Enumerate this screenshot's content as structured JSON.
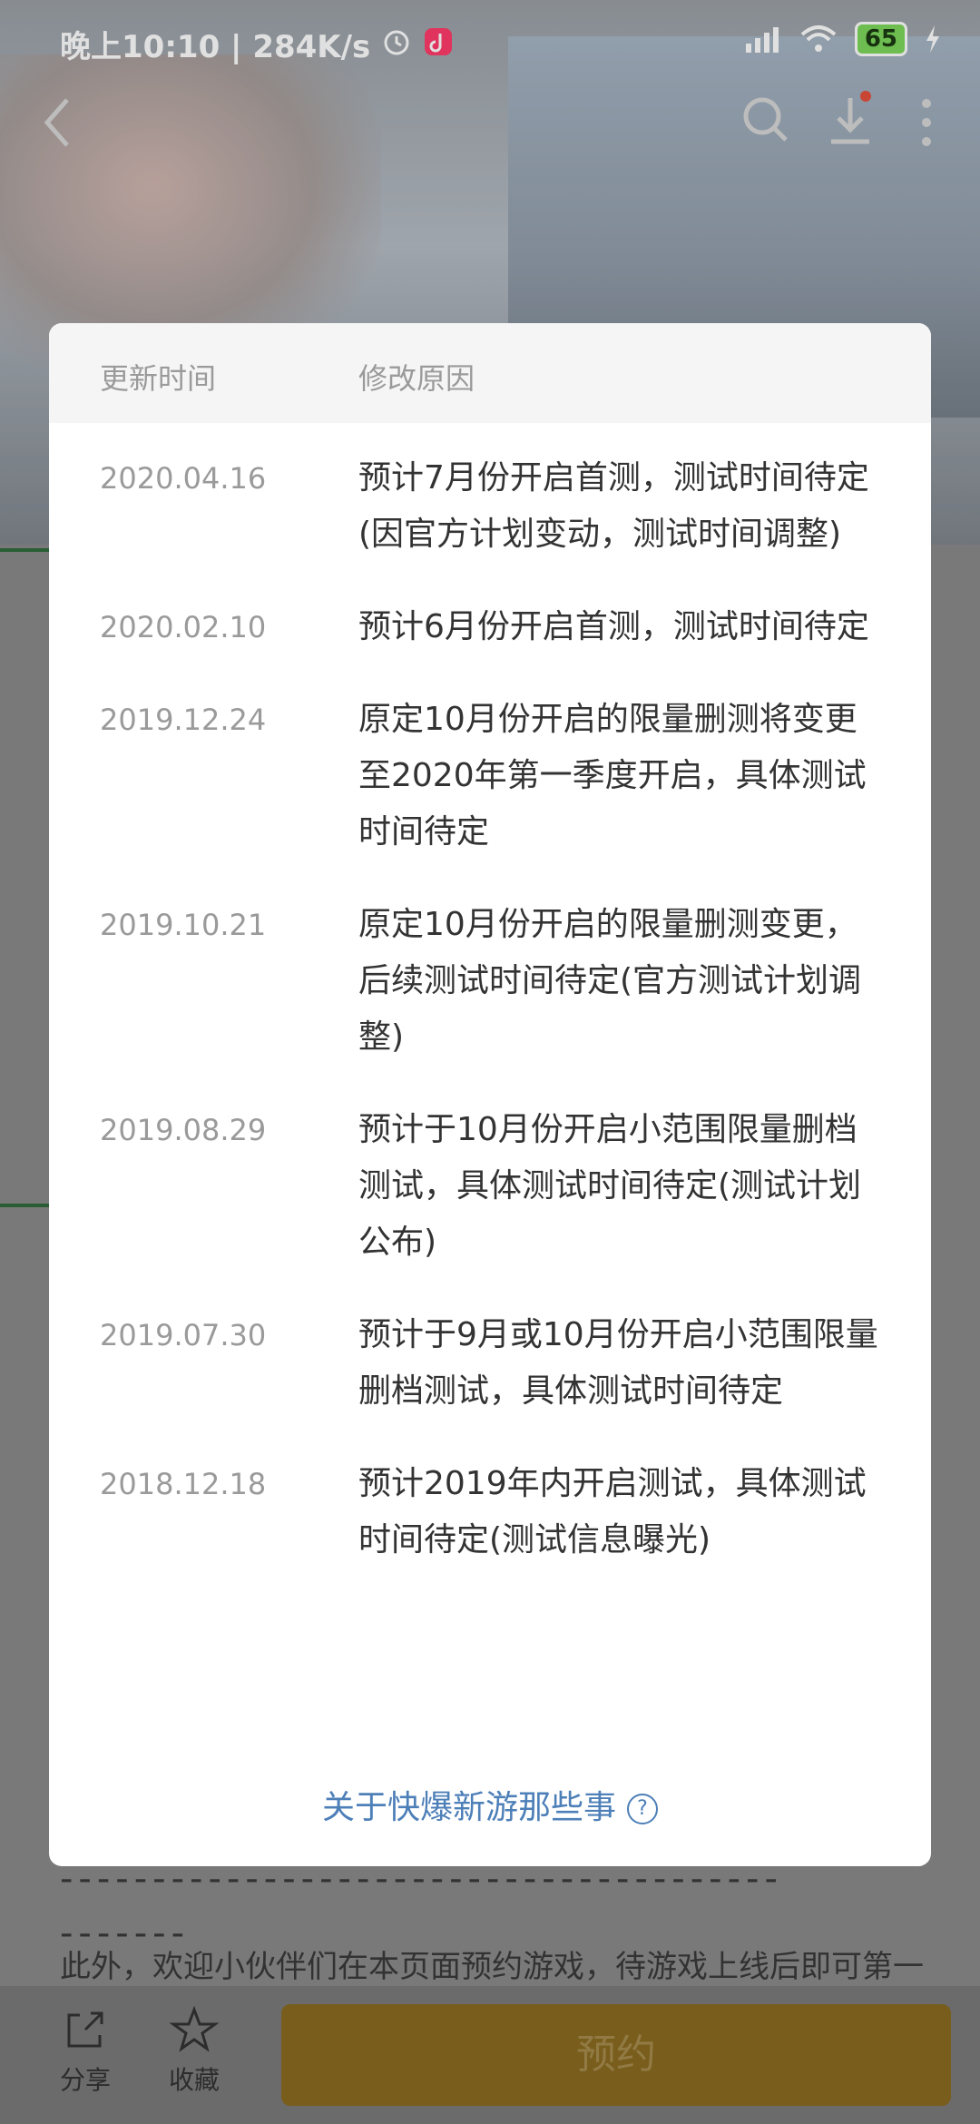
{
  "status_bar": {
    "time": "晚上10:10 | 284K/s",
    "battery": "65",
    "icons": [
      "alarm-icon",
      "tiktok-icon",
      "signal-icon",
      "wifi-icon",
      "battery-icon",
      "charging-icon"
    ]
  },
  "nav": {
    "icons": [
      "back-icon",
      "search-icon",
      "download-icon",
      "more-icon"
    ]
  },
  "dialog": {
    "header": {
      "col_time": "更新时间",
      "col_reason": "修改原因"
    },
    "rows": [
      {
        "date": "2020.04.16",
        "reason": "预计7月份开启首测，测试时间待定(因官方计划变动，测试时间调整)"
      },
      {
        "date": "2020.02.10",
        "reason": "预计6月份开启首测，测试时间待定"
      },
      {
        "date": "2019.12.24",
        "reason": "原定10月份开启的限量删测将变更至2020年第一季度开启，具体测试时间待定"
      },
      {
        "date": "2019.10.21",
        "reason": "原定10月份开启的限量删测变更，后续测试时间待定(官方测试计划调整)"
      },
      {
        "date": "2019.08.29",
        "reason": "预计于10月份开启小范围限量删档测试，具体测试时间待定(测试计划公布)"
      },
      {
        "date": "2019.07.30",
        "reason": "预计于9月或10月份开启小范围限量删档测试，具体测试时间待定"
      },
      {
        "date": "2018.12.18",
        "reason": "预计2019年内开启测试，具体测试时间待定(测试信息曝光)"
      }
    ],
    "footer_link": "关于快爆新游那些事",
    "footer_help": "?"
  },
  "background": {
    "dashes": "---------------------------------------\n-------",
    "text": "此外，欢迎小伙伴们在本页面预约游戏，待游戏上线后即可第一时"
  },
  "bottom_bar": {
    "share": "分享",
    "favorite": "收藏",
    "reserve": "预约"
  },
  "colors": {
    "link": "#4d7fb8",
    "reserve_button": "#8a6a20"
  }
}
